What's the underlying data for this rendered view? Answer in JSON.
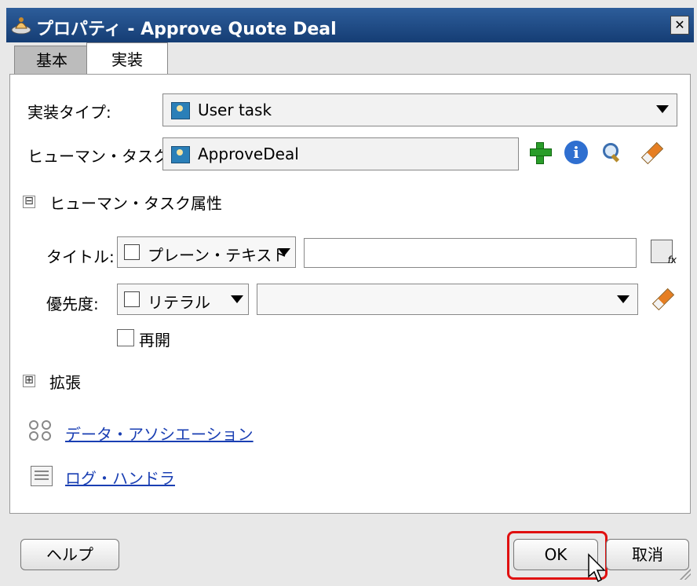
{
  "window": {
    "title": "プロパティ - Approve Quote Deal",
    "close_glyph": "✕"
  },
  "tabs": [
    {
      "label": "基本",
      "active": false
    },
    {
      "label": "実装",
      "active": true
    }
  ],
  "implementation": {
    "type_label": "実装タイプ:",
    "type_value": "User task",
    "human_task_label": "ヒューマン・タスク:",
    "human_task_value": "ApproveDeal"
  },
  "human_task_attributes": {
    "section_title": "ヒューマン・タスク属性",
    "toggle_glyph": "⊟",
    "title_label": "タイトル:",
    "title_mode": "プレーン・テキスト",
    "title_value": "",
    "priority_label": "優先度:",
    "priority_mode": "リテラル",
    "priority_value": "",
    "reopen_label": "再開",
    "reopen_checked": false
  },
  "extensions": {
    "section_title": "拡張",
    "toggle_glyph": "⊞"
  },
  "links": {
    "data_association": "データ・アソシエーション",
    "log_handler": "ログ・ハンドラ"
  },
  "buttons": {
    "help": "ヘルプ",
    "ok": "OK",
    "cancel": "取消"
  },
  "colors": {
    "title_bar": "#1f4a86",
    "highlight": "#e01010",
    "link": "#1a3fb3"
  }
}
